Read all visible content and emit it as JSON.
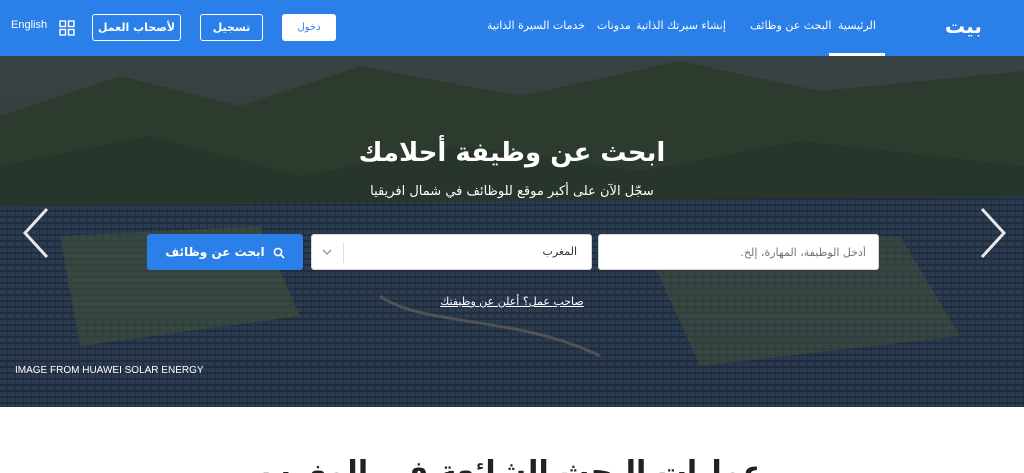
{
  "header": {
    "language": "English",
    "employers_button": "لأصحاب العمل",
    "register_button": "تسجيل",
    "login_button": "دخول",
    "nav": {
      "home": "الرئيسية",
      "job_search": "البحث عن وظائف",
      "create_cv": "إنشاء سيرتك الذاتية",
      "blog": "مدونات",
      "cv_services": "خدمات السيرة الذاتية"
    },
    "logo": "بيت"
  },
  "hero": {
    "title": "ابحث عن وظيفة أحلامك",
    "subtitle": "سجّل الآن على أكبر موقع للوظائف في شمال افريقيا",
    "search": {
      "placeholder": "أدخل الوظيفة، المهارة، إلخ.",
      "country_value": "المغرب",
      "button_label": "ابحث عن وظائف"
    },
    "employer_link": "صاحب عمل؟ أعلن عن وظيفتك",
    "image_credit": "IMAGE FROM HUAWEI SOLAR ENERGY"
  },
  "section": {
    "title": "عمليات البحث الشائعة في المغرب"
  },
  "colors": {
    "brand_blue": "#2b7fe8",
    "white": "#ffffff"
  },
  "icons": {
    "apps": "apps-grid-icon",
    "chevron": "chevron-down-icon",
    "search": "search-icon",
    "prev": "chevron-left-icon",
    "next": "chevron-right-icon"
  }
}
